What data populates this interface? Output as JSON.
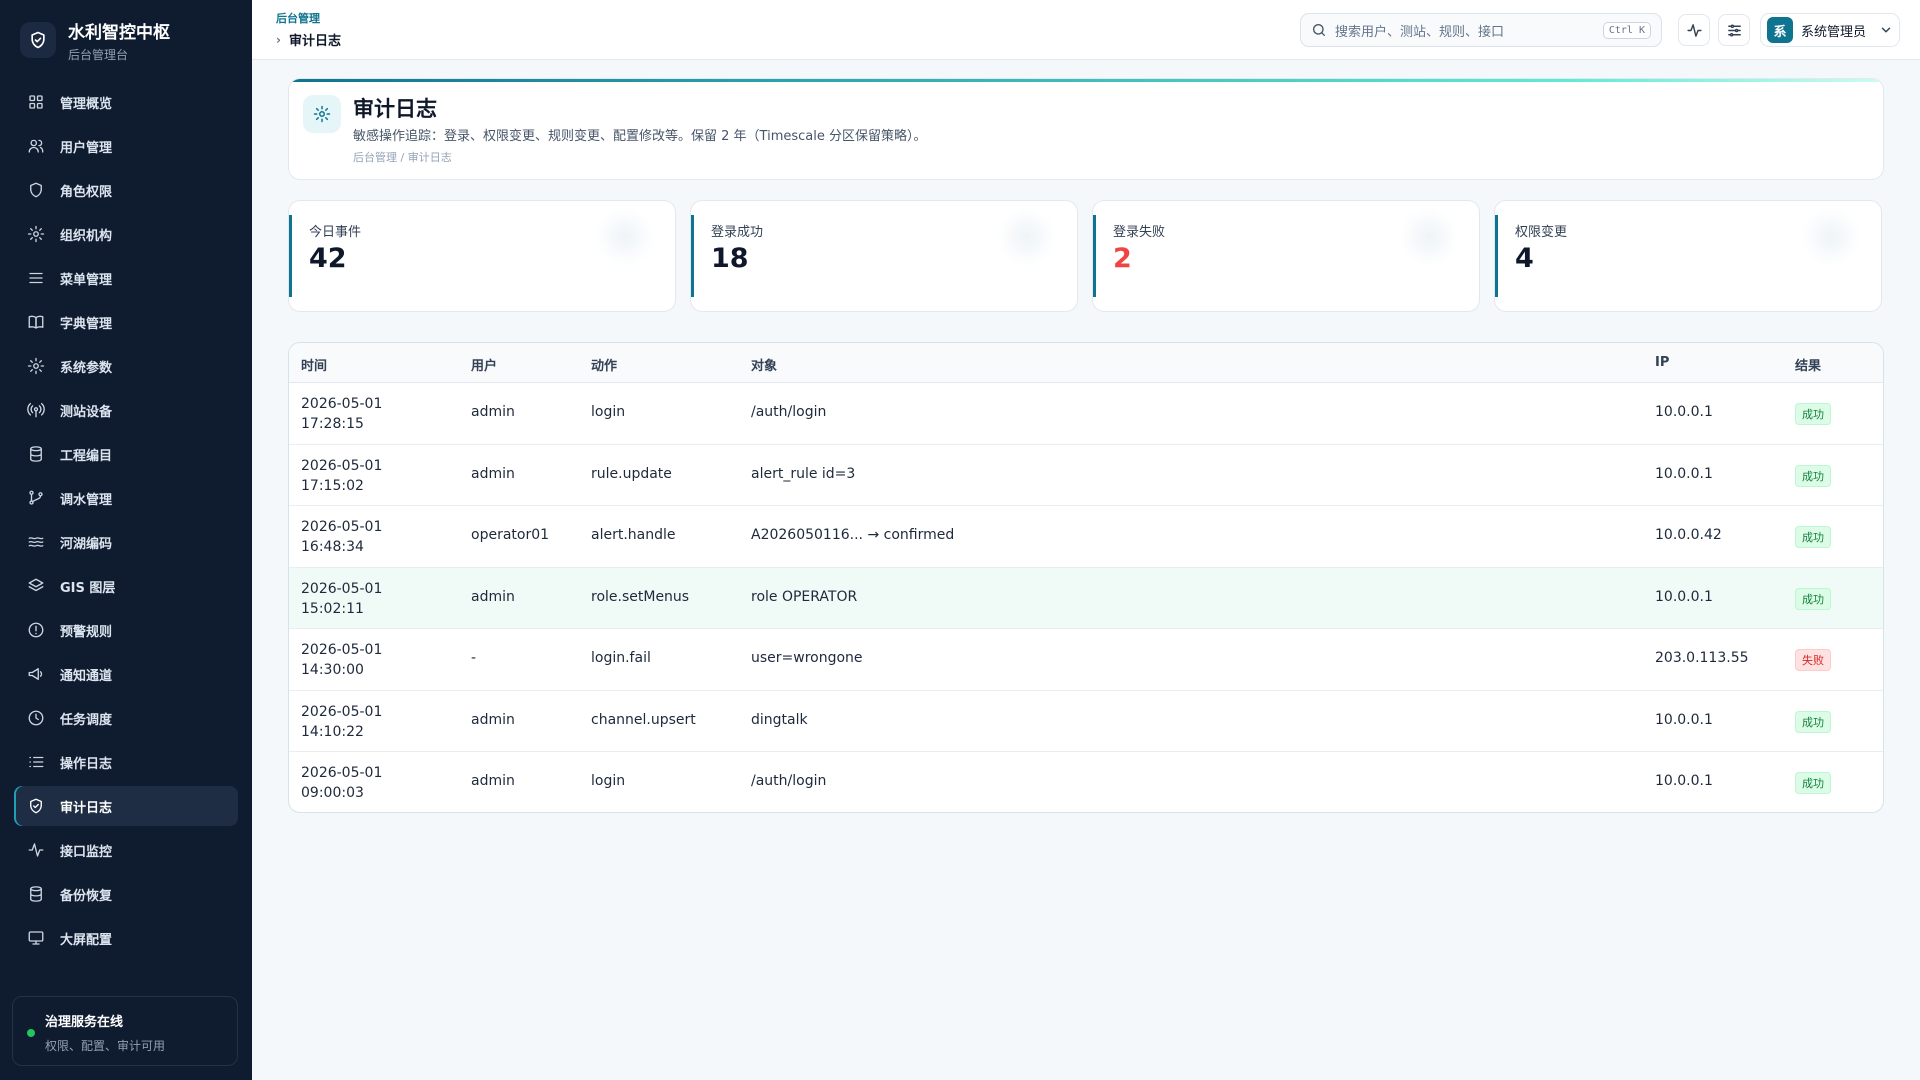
{
  "brand": {
    "title": "水利智控中枢",
    "subtitle": "后台管理台"
  },
  "sidebar": {
    "items": [
      {
        "label": "管理概览",
        "icon": "grid-icon"
      },
      {
        "label": "用户管理",
        "icon": "users-icon"
      },
      {
        "label": "角色权限",
        "icon": "shield-icon"
      },
      {
        "label": "组织机构",
        "icon": "gear-icon"
      },
      {
        "label": "菜单管理",
        "icon": "menu-icon"
      },
      {
        "label": "字典管理",
        "icon": "book-icon"
      },
      {
        "label": "系统参数",
        "icon": "gear-icon"
      },
      {
        "label": "测站设备",
        "icon": "antenna-icon"
      },
      {
        "label": "工程编目",
        "icon": "database-icon"
      },
      {
        "label": "调水管理",
        "icon": "branch-icon"
      },
      {
        "label": "河湖编码",
        "icon": "waves-icon"
      },
      {
        "label": "GIS 图层",
        "icon": "layers-icon"
      },
      {
        "label": "预警规则",
        "icon": "alert-circle-icon"
      },
      {
        "label": "通知通道",
        "icon": "megaphone-icon"
      },
      {
        "label": "任务调度",
        "icon": "clock-icon"
      },
      {
        "label": "操作日志",
        "icon": "list-icon"
      },
      {
        "label": "审计日志",
        "icon": "shield-check-icon"
      },
      {
        "label": "接口监控",
        "icon": "activity-icon"
      },
      {
        "label": "备份恢复",
        "icon": "database-icon"
      },
      {
        "label": "大屏配置",
        "icon": "monitor-icon"
      }
    ],
    "active_index": 16,
    "status": {
      "title": "治理服务在线",
      "subtitle": "权限、配置、审计可用",
      "color": "#22c55e"
    }
  },
  "topbar": {
    "crumb_parent": "后台管理",
    "crumb_current": "审计日志",
    "search_placeholder": "搜索用户、测站、规则、接口",
    "search_shortcut": "Ctrl K",
    "user_avatar": "系",
    "user_name": "系统管理员"
  },
  "header": {
    "title": "审计日志",
    "description": "敏感操作追踪：登录、权限变更、规则变更、配置修改等。保留 2 年（Timescale 分区保留策略）。",
    "breadcrumb": "后台管理 / 审计日志"
  },
  "stats": [
    {
      "label": "今日事件",
      "value": "42"
    },
    {
      "label": "登录成功",
      "value": "18"
    },
    {
      "label": "登录失败",
      "value": "2",
      "danger": true
    },
    {
      "label": "权限变更",
      "value": "4"
    }
  ],
  "table": {
    "columns": [
      "时间",
      "用户",
      "动作",
      "对象",
      "IP",
      "结果"
    ],
    "rows": [
      {
        "time": "2026-05-01\n17:28:15",
        "user": "admin",
        "action": "login",
        "target": "/auth/login",
        "ip": "10.0.0.1",
        "result": "成功",
        "ok": true
      },
      {
        "time": "2026-05-01\n17:15:02",
        "user": "admin",
        "action": "rule.update",
        "target": "alert_rule id=3",
        "ip": "10.0.0.1",
        "result": "成功",
        "ok": true
      },
      {
        "time": "2026-05-01\n16:48:34",
        "user": "operator01",
        "action": "alert.handle",
        "target": "A2026050116... → confirmed",
        "ip": "10.0.0.42",
        "result": "成功",
        "ok": true
      },
      {
        "time": "2026-05-01\n15:02:11",
        "user": "admin",
        "action": "role.setMenus",
        "target": "role OPERATOR",
        "ip": "10.0.0.1",
        "result": "成功",
        "ok": true
      },
      {
        "time": "2026-05-01\n14:30:00",
        "user": "-",
        "action": "login.fail",
        "target": "user=wrongone",
        "ip": "203.0.113.55",
        "result": "失败",
        "ok": false
      },
      {
        "time": "2026-05-01\n14:10:22",
        "user": "admin",
        "action": "channel.upsert",
        "target": "dingtalk",
        "ip": "10.0.0.1",
        "result": "成功",
        "ok": true
      },
      {
        "time": "2026-05-01\n09:00:03",
        "user": "admin",
        "action": "login",
        "target": "/auth/login",
        "ip": "10.0.0.1",
        "result": "成功",
        "ok": true
      }
    ],
    "highlighted_row": 3
  },
  "colors": {
    "sidebar_bg": "#0f1b2e",
    "accent": "#0e7490",
    "success": "#15803d",
    "danger": "#ef4444"
  }
}
